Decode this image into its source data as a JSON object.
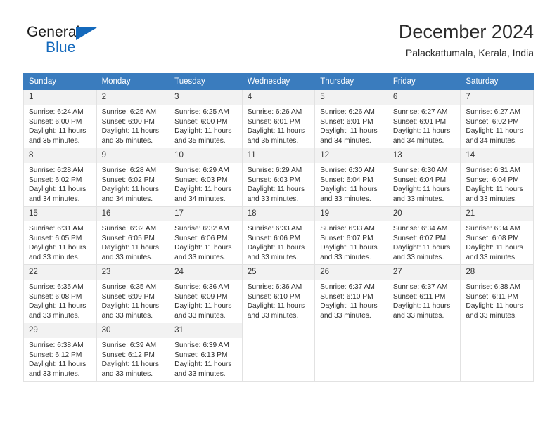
{
  "logo": {
    "text_top": "General",
    "text_bottom": "Blue",
    "accent_color": "#1469bc",
    "triangle_icon": "triangle-icon"
  },
  "header": {
    "title": "December 2024",
    "subtitle": "Palackattumala, Kerala, India"
  },
  "theme": {
    "header_bg": "#3a7cbe",
    "daynum_bg": "#f2f2f2",
    "cell_border": "#e2e2e2"
  },
  "calendar": {
    "weekday_headers": [
      "Sunday",
      "Monday",
      "Tuesday",
      "Wednesday",
      "Thursday",
      "Friday",
      "Saturday"
    ],
    "weeks": [
      [
        {
          "day": "1",
          "sunrise": "Sunrise: 6:24 AM",
          "sunset": "Sunset: 6:00 PM",
          "daylight": "Daylight: 11 hours and 35 minutes."
        },
        {
          "day": "2",
          "sunrise": "Sunrise: 6:25 AM",
          "sunset": "Sunset: 6:00 PM",
          "daylight": "Daylight: 11 hours and 35 minutes."
        },
        {
          "day": "3",
          "sunrise": "Sunrise: 6:25 AM",
          "sunset": "Sunset: 6:00 PM",
          "daylight": "Daylight: 11 hours and 35 minutes."
        },
        {
          "day": "4",
          "sunrise": "Sunrise: 6:26 AM",
          "sunset": "Sunset: 6:01 PM",
          "daylight": "Daylight: 11 hours and 35 minutes."
        },
        {
          "day": "5",
          "sunrise": "Sunrise: 6:26 AM",
          "sunset": "Sunset: 6:01 PM",
          "daylight": "Daylight: 11 hours and 34 minutes."
        },
        {
          "day": "6",
          "sunrise": "Sunrise: 6:27 AM",
          "sunset": "Sunset: 6:01 PM",
          "daylight": "Daylight: 11 hours and 34 minutes."
        },
        {
          "day": "7",
          "sunrise": "Sunrise: 6:27 AM",
          "sunset": "Sunset: 6:02 PM",
          "daylight": "Daylight: 11 hours and 34 minutes."
        }
      ],
      [
        {
          "day": "8",
          "sunrise": "Sunrise: 6:28 AM",
          "sunset": "Sunset: 6:02 PM",
          "daylight": "Daylight: 11 hours and 34 minutes."
        },
        {
          "day": "9",
          "sunrise": "Sunrise: 6:28 AM",
          "sunset": "Sunset: 6:02 PM",
          "daylight": "Daylight: 11 hours and 34 minutes."
        },
        {
          "day": "10",
          "sunrise": "Sunrise: 6:29 AM",
          "sunset": "Sunset: 6:03 PM",
          "daylight": "Daylight: 11 hours and 34 minutes."
        },
        {
          "day": "11",
          "sunrise": "Sunrise: 6:29 AM",
          "sunset": "Sunset: 6:03 PM",
          "daylight": "Daylight: 11 hours and 33 minutes."
        },
        {
          "day": "12",
          "sunrise": "Sunrise: 6:30 AM",
          "sunset": "Sunset: 6:04 PM",
          "daylight": "Daylight: 11 hours and 33 minutes."
        },
        {
          "day": "13",
          "sunrise": "Sunrise: 6:30 AM",
          "sunset": "Sunset: 6:04 PM",
          "daylight": "Daylight: 11 hours and 33 minutes."
        },
        {
          "day": "14",
          "sunrise": "Sunrise: 6:31 AM",
          "sunset": "Sunset: 6:04 PM",
          "daylight": "Daylight: 11 hours and 33 minutes."
        }
      ],
      [
        {
          "day": "15",
          "sunrise": "Sunrise: 6:31 AM",
          "sunset": "Sunset: 6:05 PM",
          "daylight": "Daylight: 11 hours and 33 minutes."
        },
        {
          "day": "16",
          "sunrise": "Sunrise: 6:32 AM",
          "sunset": "Sunset: 6:05 PM",
          "daylight": "Daylight: 11 hours and 33 minutes."
        },
        {
          "day": "17",
          "sunrise": "Sunrise: 6:32 AM",
          "sunset": "Sunset: 6:06 PM",
          "daylight": "Daylight: 11 hours and 33 minutes."
        },
        {
          "day": "18",
          "sunrise": "Sunrise: 6:33 AM",
          "sunset": "Sunset: 6:06 PM",
          "daylight": "Daylight: 11 hours and 33 minutes."
        },
        {
          "day": "19",
          "sunrise": "Sunrise: 6:33 AM",
          "sunset": "Sunset: 6:07 PM",
          "daylight": "Daylight: 11 hours and 33 minutes."
        },
        {
          "day": "20",
          "sunrise": "Sunrise: 6:34 AM",
          "sunset": "Sunset: 6:07 PM",
          "daylight": "Daylight: 11 hours and 33 minutes."
        },
        {
          "day": "21",
          "sunrise": "Sunrise: 6:34 AM",
          "sunset": "Sunset: 6:08 PM",
          "daylight": "Daylight: 11 hours and 33 minutes."
        }
      ],
      [
        {
          "day": "22",
          "sunrise": "Sunrise: 6:35 AM",
          "sunset": "Sunset: 6:08 PM",
          "daylight": "Daylight: 11 hours and 33 minutes."
        },
        {
          "day": "23",
          "sunrise": "Sunrise: 6:35 AM",
          "sunset": "Sunset: 6:09 PM",
          "daylight": "Daylight: 11 hours and 33 minutes."
        },
        {
          "day": "24",
          "sunrise": "Sunrise: 6:36 AM",
          "sunset": "Sunset: 6:09 PM",
          "daylight": "Daylight: 11 hours and 33 minutes."
        },
        {
          "day": "25",
          "sunrise": "Sunrise: 6:36 AM",
          "sunset": "Sunset: 6:10 PM",
          "daylight": "Daylight: 11 hours and 33 minutes."
        },
        {
          "day": "26",
          "sunrise": "Sunrise: 6:37 AM",
          "sunset": "Sunset: 6:10 PM",
          "daylight": "Daylight: 11 hours and 33 minutes."
        },
        {
          "day": "27",
          "sunrise": "Sunrise: 6:37 AM",
          "sunset": "Sunset: 6:11 PM",
          "daylight": "Daylight: 11 hours and 33 minutes."
        },
        {
          "day": "28",
          "sunrise": "Sunrise: 6:38 AM",
          "sunset": "Sunset: 6:11 PM",
          "daylight": "Daylight: 11 hours and 33 minutes."
        }
      ],
      [
        {
          "day": "29",
          "sunrise": "Sunrise: 6:38 AM",
          "sunset": "Sunset: 6:12 PM",
          "daylight": "Daylight: 11 hours and 33 minutes."
        },
        {
          "day": "30",
          "sunrise": "Sunrise: 6:39 AM",
          "sunset": "Sunset: 6:12 PM",
          "daylight": "Daylight: 11 hours and 33 minutes."
        },
        {
          "day": "31",
          "sunrise": "Sunrise: 6:39 AM",
          "sunset": "Sunset: 6:13 PM",
          "daylight": "Daylight: 11 hours and 33 minutes."
        },
        {
          "day": "",
          "sunrise": "",
          "sunset": "",
          "daylight": ""
        },
        {
          "day": "",
          "sunrise": "",
          "sunset": "",
          "daylight": ""
        },
        {
          "day": "",
          "sunrise": "",
          "sunset": "",
          "daylight": ""
        },
        {
          "day": "",
          "sunrise": "",
          "sunset": "",
          "daylight": ""
        }
      ]
    ]
  }
}
